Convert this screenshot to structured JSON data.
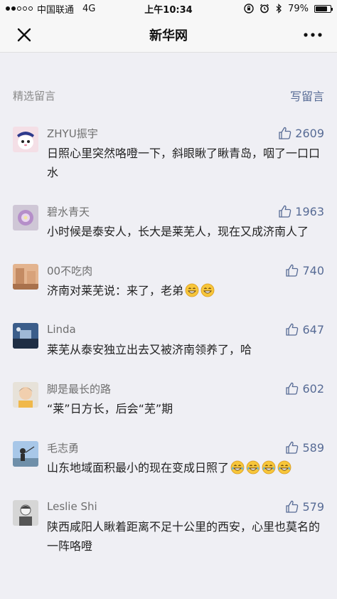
{
  "status_bar": {
    "carrier": "中国联通",
    "network": "4G",
    "time": "上午10:34",
    "battery": "79%",
    "battery_level": 0.79
  },
  "nav": {
    "title": "新华网"
  },
  "section": {
    "title": "精选留言",
    "write_label": "写留言"
  },
  "colors": {
    "link": "#576b95",
    "name": "#6f6f6f",
    "background": "#efeff4"
  },
  "comments": [
    {
      "name": "ZHYU振宇",
      "likes": "2609",
      "text": "日照心里突然咯噔一下，斜眼瞅了瞅青岛，咽了一口口水",
      "emojis": []
    },
    {
      "name": "碧水青天",
      "likes": "1963",
      "text": "小时候是泰安人，长大是莱芜人，现在又成济南人了",
      "emojis": []
    },
    {
      "name": "00不吃肉",
      "likes": "740",
      "text": "济南对莱芜说：来了，老弟",
      "emojis": [
        "grin-emoji",
        "grin-emoji"
      ]
    },
    {
      "name": "Linda",
      "likes": "647",
      "text": "莱芜从泰安独立出去又被济南领养了，哈",
      "emojis": []
    },
    {
      "name": "脚是最长的路",
      "likes": "602",
      "text": "“莱”日方长，后会“芜”期",
      "emojis": []
    },
    {
      "name": "毛志勇",
      "likes": "589",
      "text": "山东地域面积最小的现在变成日照了",
      "emojis": [
        "tears-of-joy-emoji",
        "tears-of-joy-emoji",
        "tears-of-joy-emoji",
        "tears-of-joy-emoji"
      ]
    },
    {
      "name": "Leslie Shi",
      "likes": "579",
      "text": "陕西咸阳人瞅着距离不足十公里的西安，心里也莫名的一阵咯噔",
      "emojis": []
    }
  ]
}
